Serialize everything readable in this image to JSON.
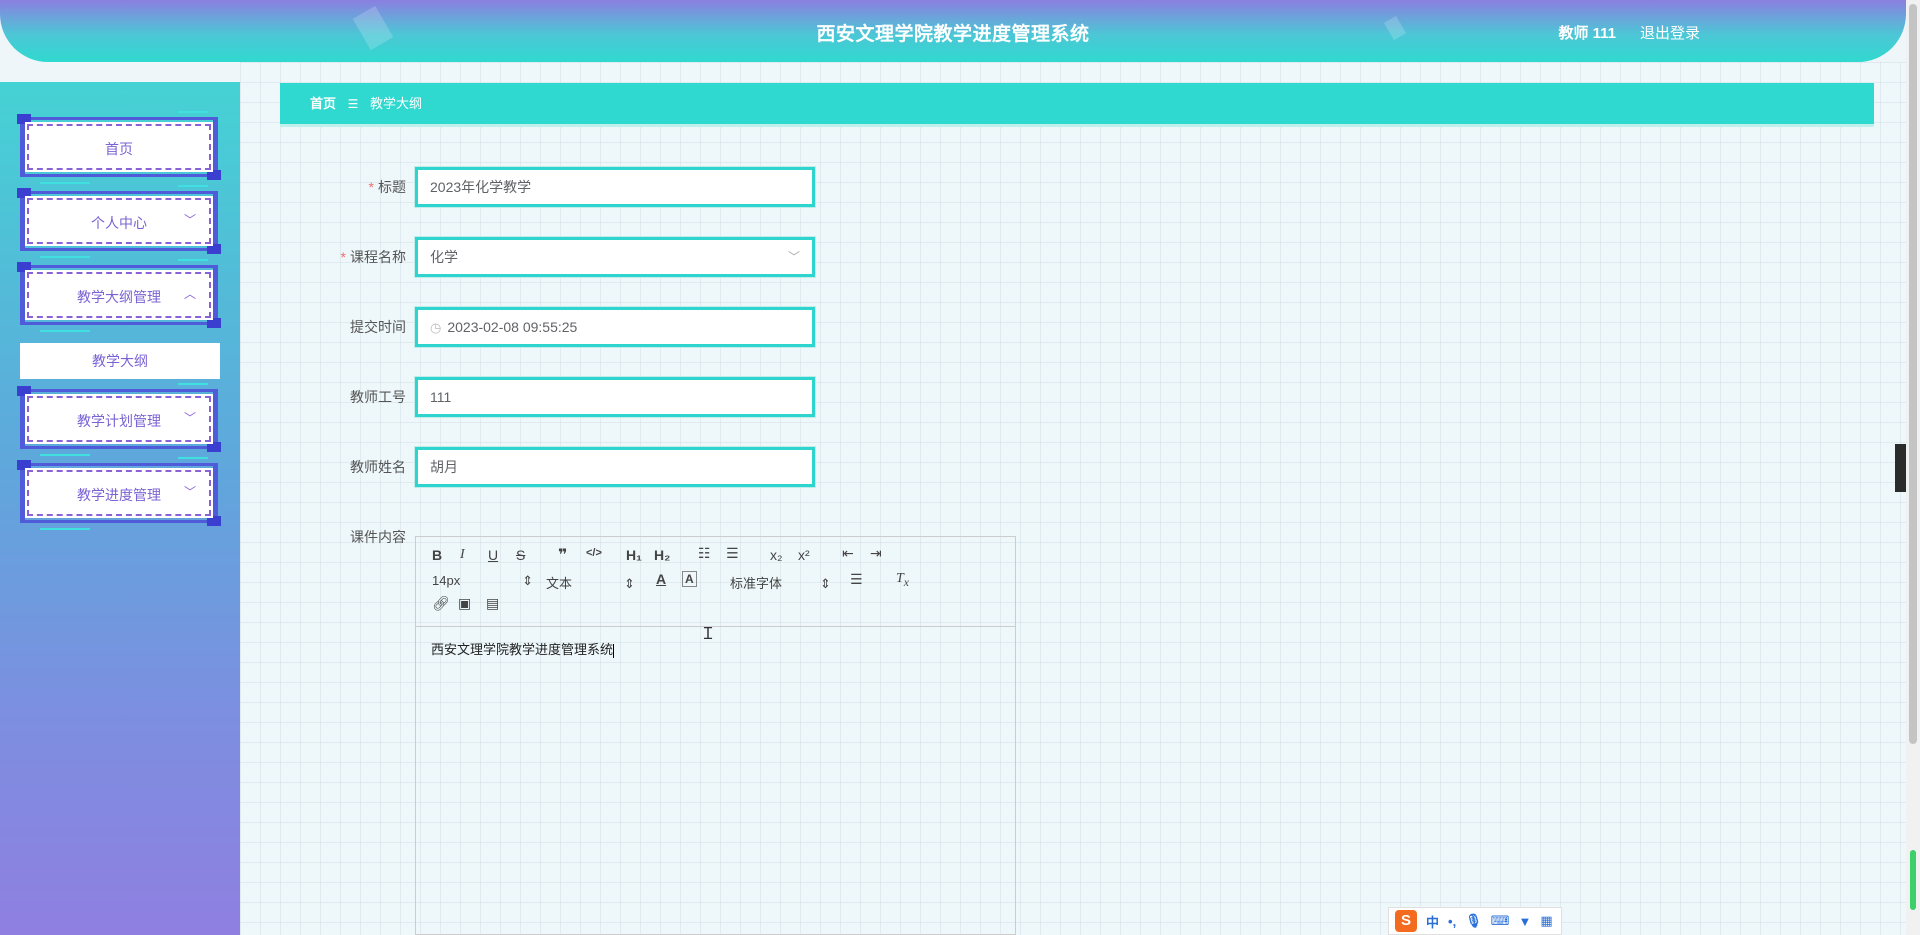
{
  "header": {
    "title": "西安文理学院教学进度管理系统",
    "user": "教师 111",
    "logout": "退出登录"
  },
  "sidebar": {
    "items": [
      {
        "label": "首页",
        "expandable": false
      },
      {
        "label": "个人中心",
        "expandable": true,
        "chevron": "﹀"
      },
      {
        "label": "教学大纲管理",
        "expandable": true,
        "chevron": "︿"
      },
      {
        "label": "教学计划管理",
        "expandable": true,
        "chevron": "﹀"
      },
      {
        "label": "教学进度管理",
        "expandable": true,
        "chevron": "﹀"
      }
    ],
    "submenu_active": "教学大纲"
  },
  "breadcrumb": {
    "home": "首页",
    "separator": "☰",
    "current": "教学大纲"
  },
  "form": {
    "title_label": "标题",
    "title_value": "2023年化学教学",
    "course_label": "课程名称",
    "course_value": "化学",
    "submit_time_label": "提交时间",
    "submit_time_value": "2023-02-08 09:55:25",
    "teacher_id_label": "教师工号",
    "teacher_id_value": "111",
    "teacher_name_label": "教师姓名",
    "teacher_name_value": "胡月",
    "content_label": "课件内容"
  },
  "editor": {
    "font_size": "14px",
    "block_type": "文本",
    "font_family": "标准字体",
    "content": "西安文理学院教学进度管理系统"
  },
  "ime": {
    "logo": "S",
    "mode": "中"
  },
  "colors": {
    "accent": "#2fd9cf",
    "menu_text": "#7b63d3",
    "required": "#f56c6c"
  }
}
